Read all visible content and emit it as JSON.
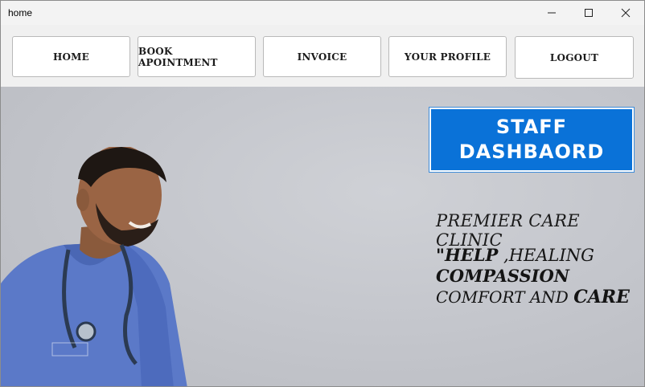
{
  "window": {
    "title": "home"
  },
  "nav": {
    "items": [
      "HOME",
      "BOOK APOINTMENT",
      "INVOICE",
      "YOUR PROFILE",
      "LOGOUT"
    ]
  },
  "dashboard": {
    "label": "STAFF\nDASHBAORD"
  },
  "clinic": {
    "name": "PREMIER CARE CLINIC",
    "motto_help": "\"HELP",
    "motto_healing": " ,HEALING",
    "motto_compassion": "COMPASSION",
    "motto_comfort": "COMFORT AND ",
    "motto_care": "CARE"
  },
  "icons": {
    "minimize": "minimize-icon",
    "maximize": "maximize-icon",
    "close": "close-icon"
  },
  "colors": {
    "accent": "#0a72d8",
    "background": "#c3c5cc",
    "scrubs": "#5a78c9"
  }
}
